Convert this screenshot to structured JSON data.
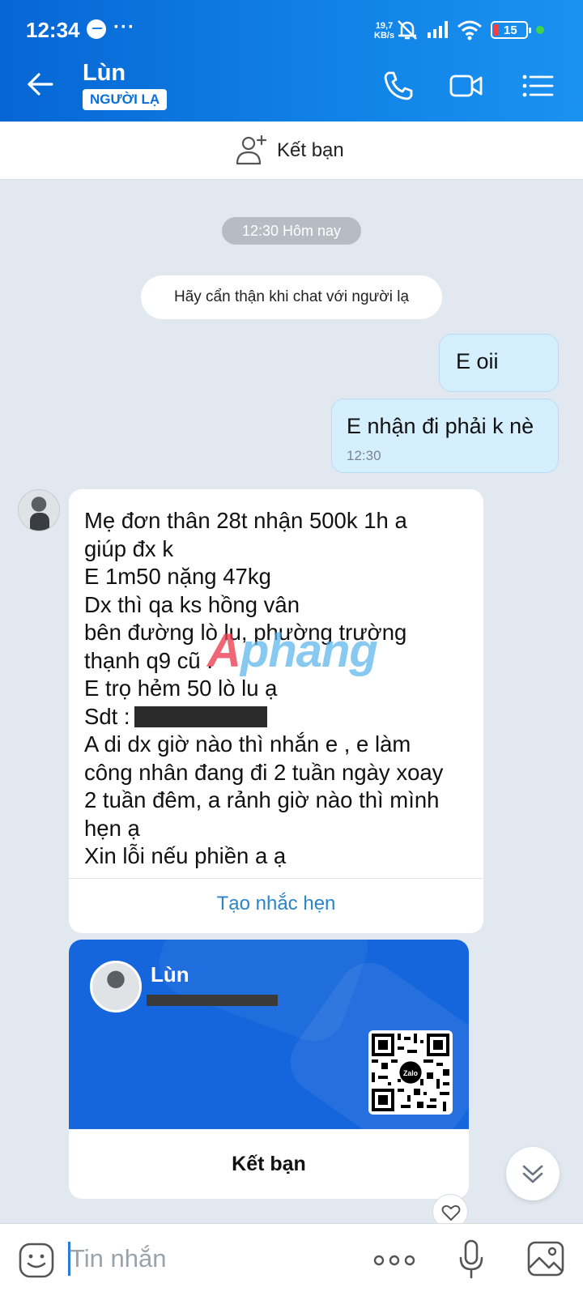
{
  "status_bar": {
    "time": "12:34",
    "net_speed_value": "19,7",
    "net_speed_unit": "KB/s",
    "battery": "15"
  },
  "header": {
    "contact_name": "Lùn",
    "stranger_badge": "NGƯỜI LẠ"
  },
  "friend_bar": {
    "label": "Kết bạn"
  },
  "chat": {
    "time_divider": "12:30 Hôm nay",
    "warning": "Hãy cẩn thận khi chat với người lạ",
    "outgoing": [
      {
        "text": "E oii"
      },
      {
        "text": "E nhận đi phải k nè",
        "time": "12:30"
      }
    ],
    "incoming_text": "Mẹ đơn thân 28t nhận 500k 1h a\ngiúp đx k\nE 1m50 nặng 47kg\nDx thì qa ks hồng vân\nbên đường lò lu, phường trường\nthạnh q9 cũ .\nE trọ hẻm 50 lò lu ạ\nSdt :\nA di dx giờ nào thì nhắn e , e làm\ncông nhân đang đi 2 tuần ngày xoay\n2 tuần đêm, a rảnh giờ nào thì mình\nhẹn ạ\nXin lỗi nếu phiền a ạ",
    "reminder_label": "Tạo nhắc hẹn",
    "watermark_a": "A",
    "watermark_rest": "phang",
    "contact_card": {
      "name": "Lùn",
      "qr_brand": "Zalo",
      "button": "Kết bạn"
    }
  },
  "composer": {
    "placeholder": "Tin nhắn"
  }
}
